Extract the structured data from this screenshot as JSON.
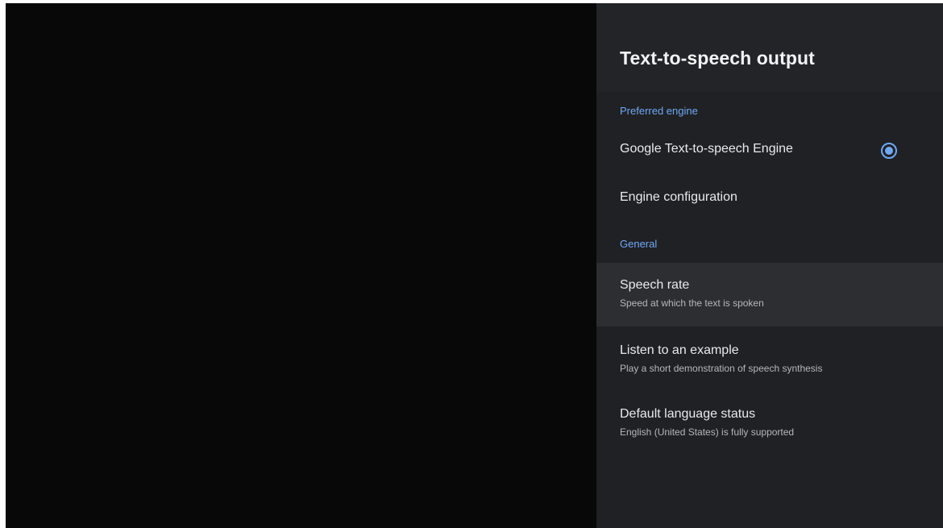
{
  "panel": {
    "title": "Text-to-speech output",
    "sections": {
      "preferred_engine": "Preferred engine",
      "general": "General"
    },
    "engine_item": {
      "label": "Google Text-to-speech Engine",
      "selected": true,
      "icon": "radio-checked-icon"
    },
    "engine_config": {
      "label": "Engine configuration"
    },
    "speech_rate": {
      "label": "Speech rate",
      "description": "Speed at which the text is spoken"
    },
    "listen_example": {
      "label": "Listen to an example",
      "description": "Play a short demonstration of speech synthesis"
    },
    "language_status": {
      "label": "Default language status",
      "description": "English (United States) is fully supported"
    }
  },
  "colors": {
    "accent": "#6fa8f5",
    "panel_bg": "#202124",
    "focused_bg": "#2d2e32",
    "screen_bg": "#080808"
  }
}
